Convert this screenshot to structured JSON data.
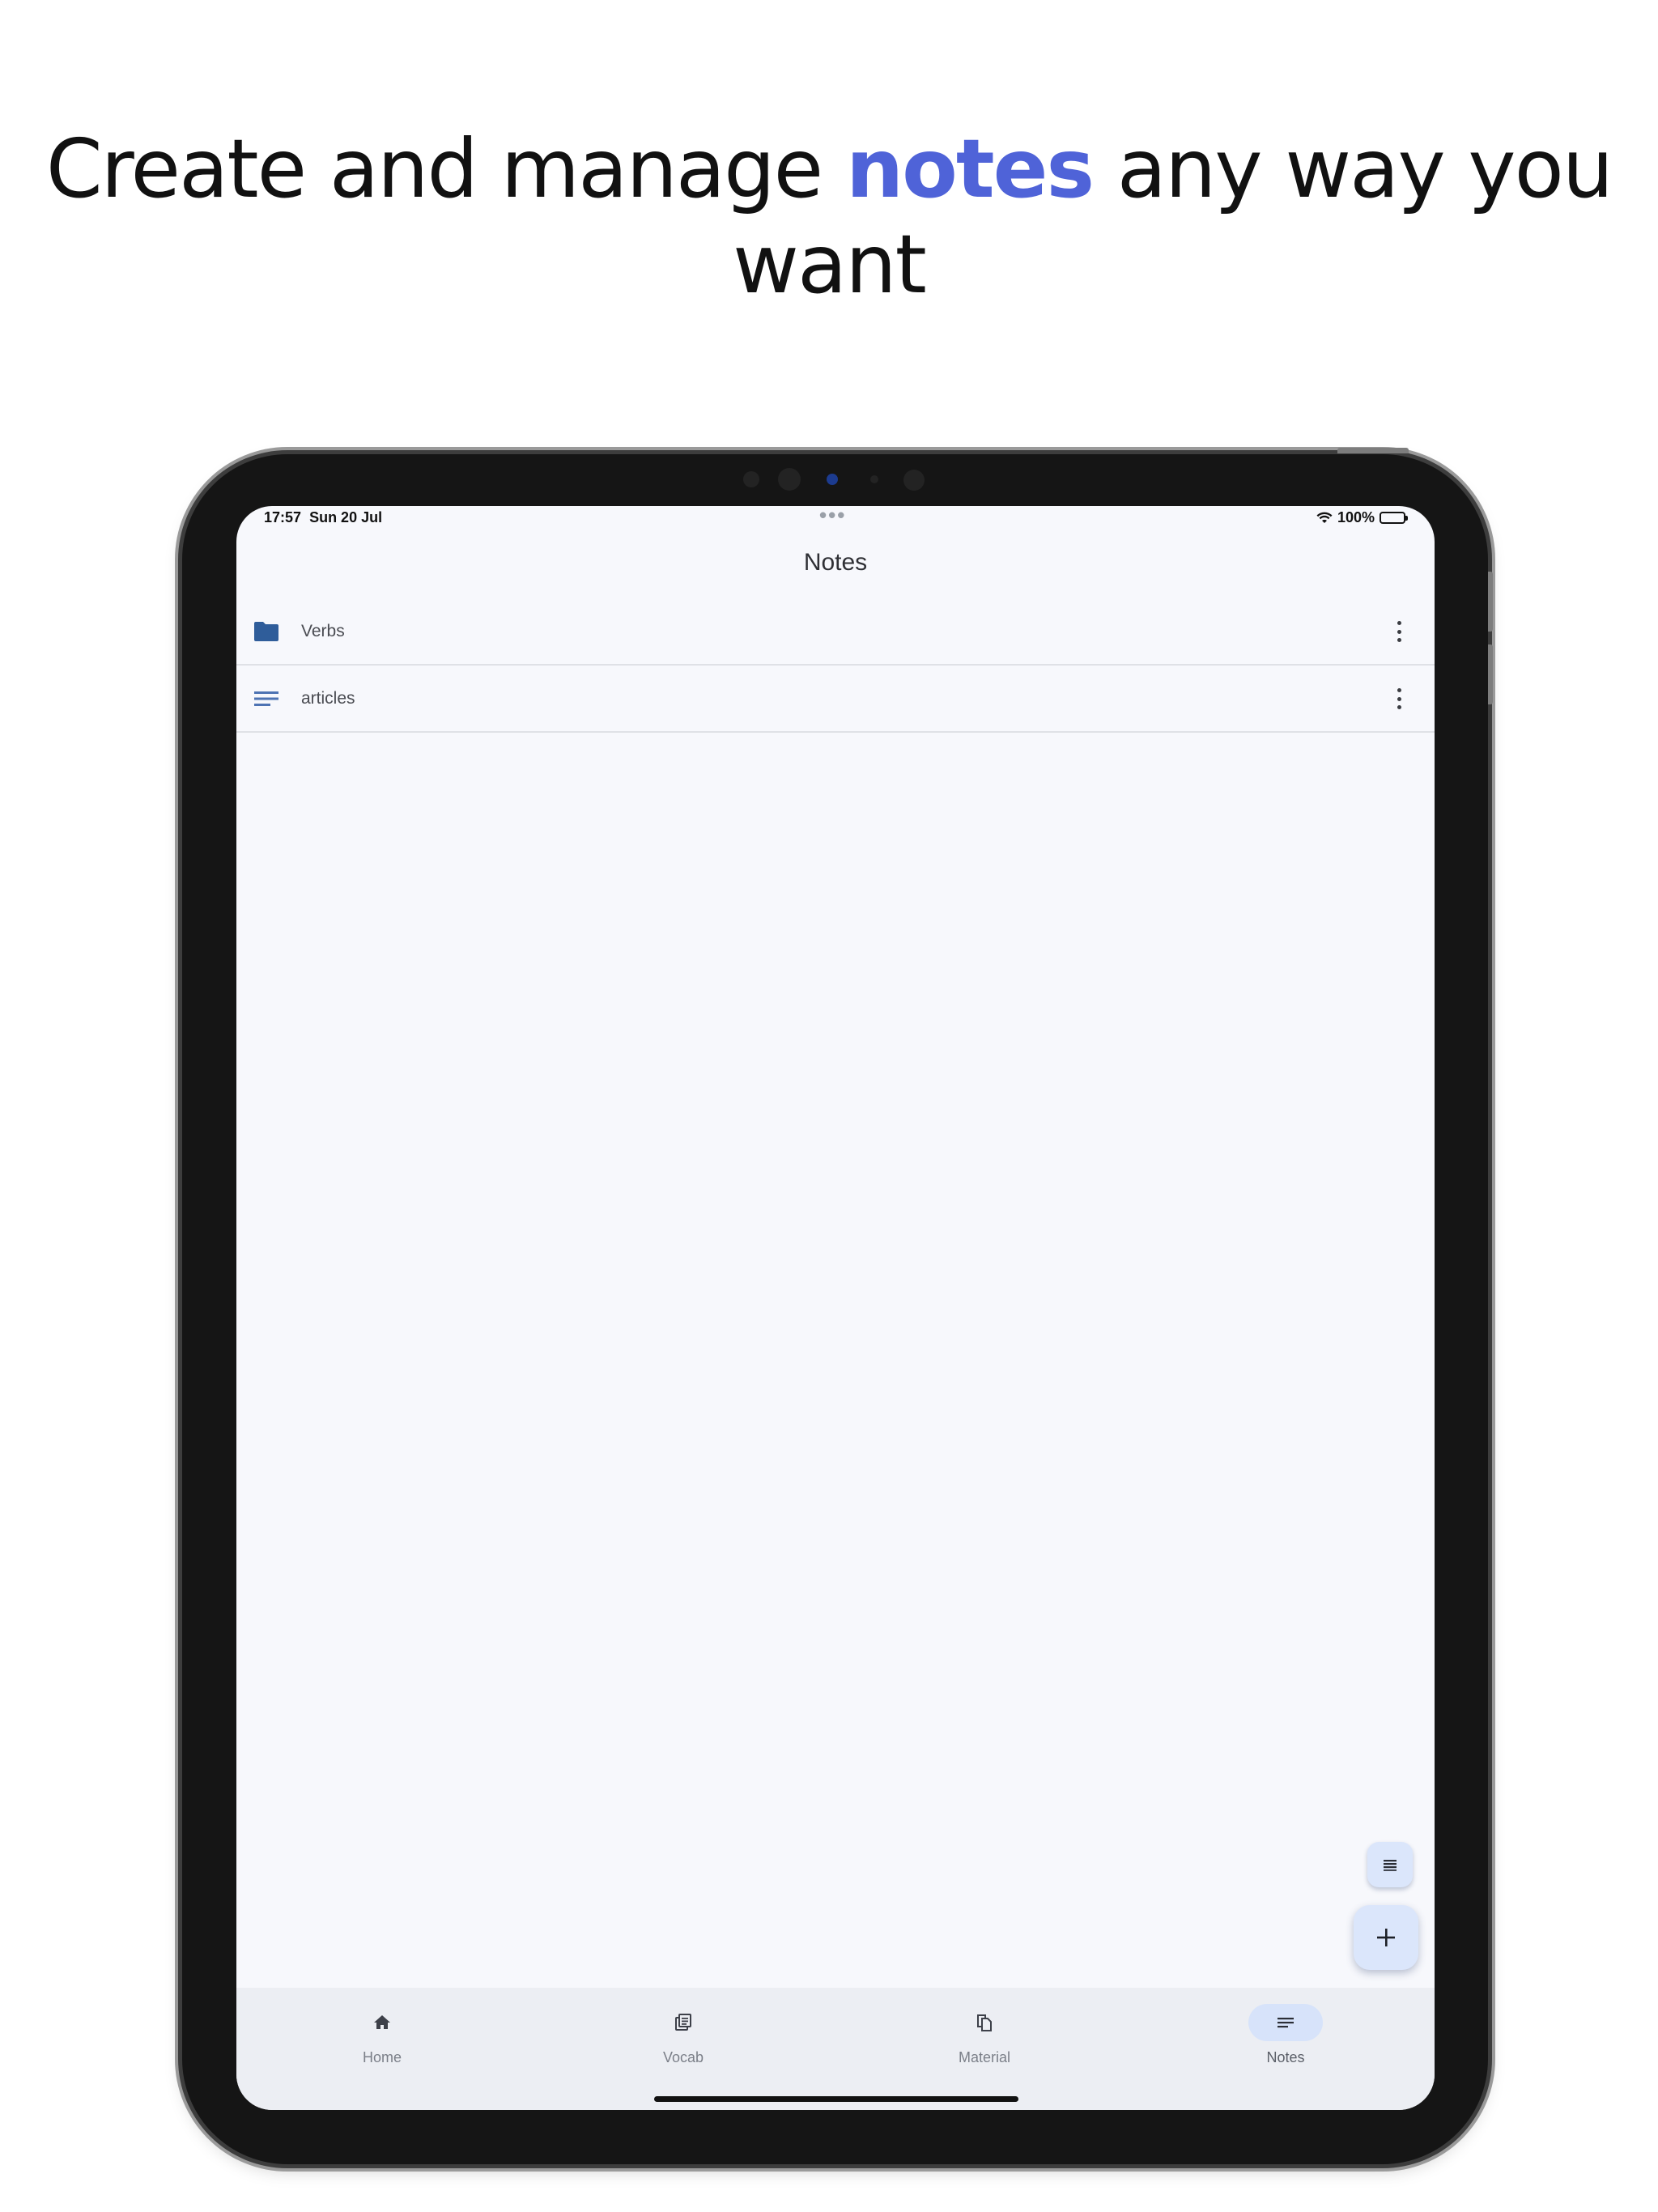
{
  "headline": {
    "before": "Create and manage ",
    "highlight": "notes",
    "after": " any way you want"
  },
  "colors": {
    "highlight": "#4f63d8",
    "folder_icon": "#2f5d9a",
    "fab_bg": "#dbe6fb",
    "nav_active_pill": "#d7e3fa"
  },
  "status": {
    "time": "17:57",
    "date": "Sun 20 Jul",
    "battery": "100%"
  },
  "appbar": {
    "title": "Notes"
  },
  "list": [
    {
      "label": "Verbs",
      "icon": "folder-icon"
    },
    {
      "label": "articles",
      "icon": "note-lines-icon"
    }
  ],
  "fabs": {
    "small_icon": "list-icon",
    "main_icon": "plus-icon"
  },
  "nav": {
    "items": [
      {
        "label": "Home",
        "icon": "home-icon"
      },
      {
        "label": "Vocab",
        "icon": "vocab-icon"
      },
      {
        "label": "Material",
        "icon": "material-icon"
      },
      {
        "label": "Notes",
        "icon": "notes-icon"
      }
    ],
    "active": "Notes"
  }
}
